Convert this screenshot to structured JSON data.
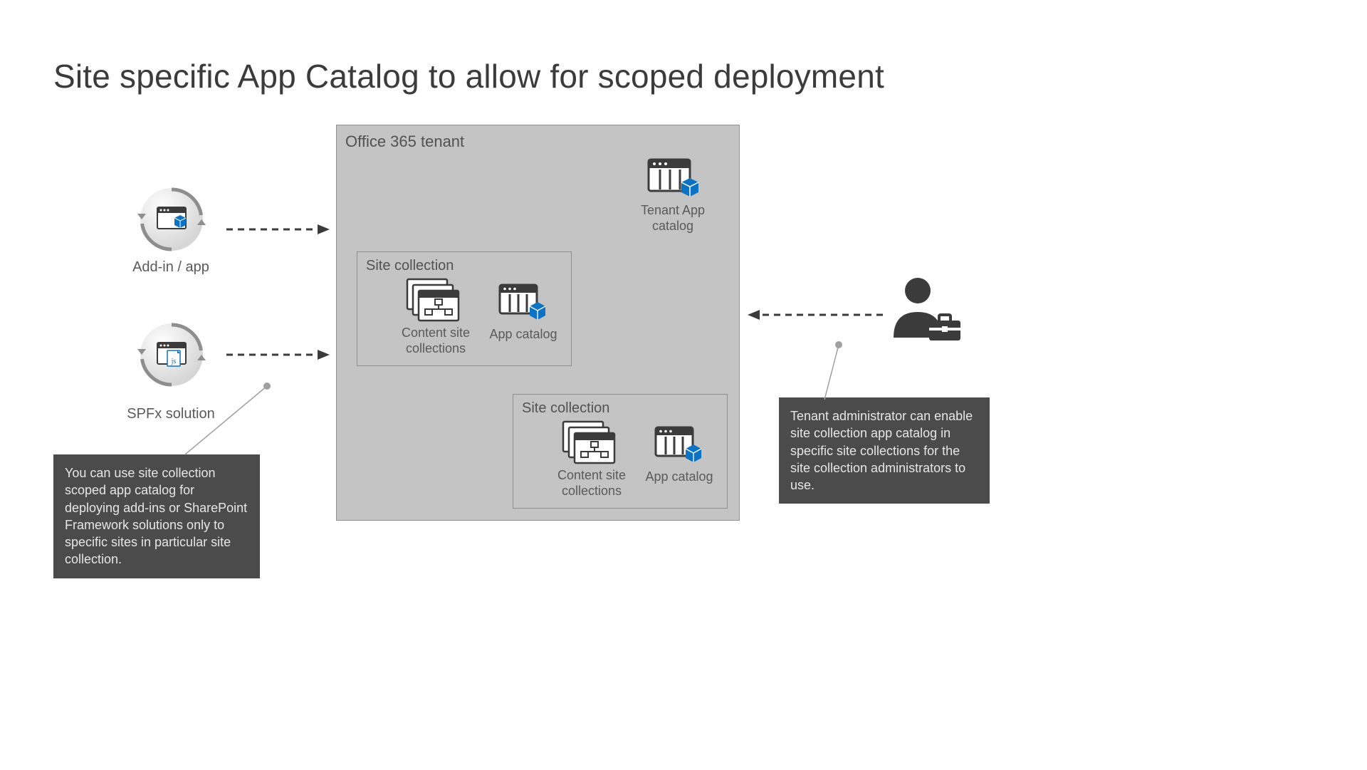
{
  "title": "Site specific App Catalog to allow for scoped deployment",
  "left": {
    "addin_label": "Add-in / app",
    "spfx_label": "SPFx solution"
  },
  "tenant": {
    "label": "Office 365 tenant",
    "tenant_catalog_label": "Tenant App catalog",
    "sc1": {
      "label": "Site collection",
      "content_label": "Content site collections",
      "catalog_label": "App catalog"
    },
    "sc2": {
      "label": "Site collection",
      "content_label": "Content site collections",
      "catalog_label": "App catalog"
    }
  },
  "annot": {
    "left": "You can use site collection scoped app catalog for deploying add-ins or SharePoint Framework solutions only to specific sites in particular site collection.",
    "right": "Tenant administrator can enable site collection app catalog in specific site collections for the site collection administrators to use."
  }
}
